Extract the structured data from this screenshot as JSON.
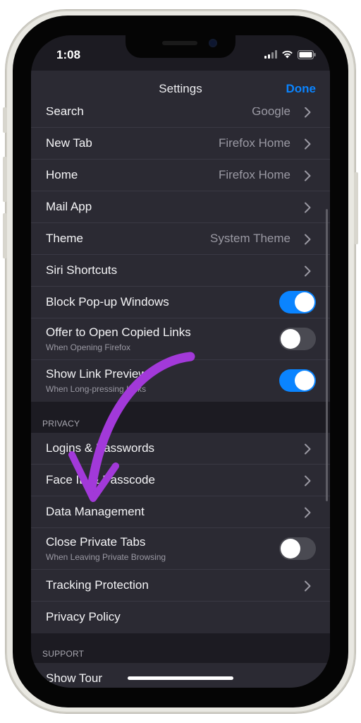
{
  "status_bar": {
    "time": "1:08"
  },
  "nav": {
    "title": "Settings",
    "done_label": "Done"
  },
  "general": {
    "search": {
      "label": "Search",
      "value": "Google"
    },
    "new_tab": {
      "label": "New Tab",
      "value": "Firefox Home"
    },
    "home": {
      "label": "Home",
      "value": "Firefox Home"
    },
    "mail_app": {
      "label": "Mail App"
    },
    "theme": {
      "label": "Theme",
      "value": "System Theme"
    },
    "siri_shortcuts": {
      "label": "Siri Shortcuts"
    },
    "block_popups": {
      "label": "Block Pop-up Windows",
      "enabled": true
    },
    "offer_open_links": {
      "label": "Offer to Open Copied Links",
      "subtitle": "When Opening Firefox",
      "enabled": false
    },
    "show_link_previews": {
      "label": "Show Link Previews",
      "subtitle": "When Long-pressing Links",
      "enabled": true
    }
  },
  "privacy": {
    "header": "PRIVACY",
    "logins": {
      "label": "Logins & Passwords"
    },
    "face_id": {
      "label": "Face ID & Passcode"
    },
    "data_management": {
      "label": "Data Management"
    },
    "close_private_tabs": {
      "label": "Close Private Tabs",
      "subtitle": "When Leaving Private Browsing",
      "enabled": false
    },
    "tracking_protection": {
      "label": "Tracking Protection"
    },
    "privacy_policy": {
      "label": "Privacy Policy"
    }
  },
  "support": {
    "header": "SUPPORT",
    "show_tour": {
      "label": "Show Tour"
    }
  },
  "colors": {
    "accent": "#0a84ff",
    "row_background": "#2b2a33",
    "page_background": "#1c1b22",
    "annotation_arrow": "#a239d9"
  }
}
